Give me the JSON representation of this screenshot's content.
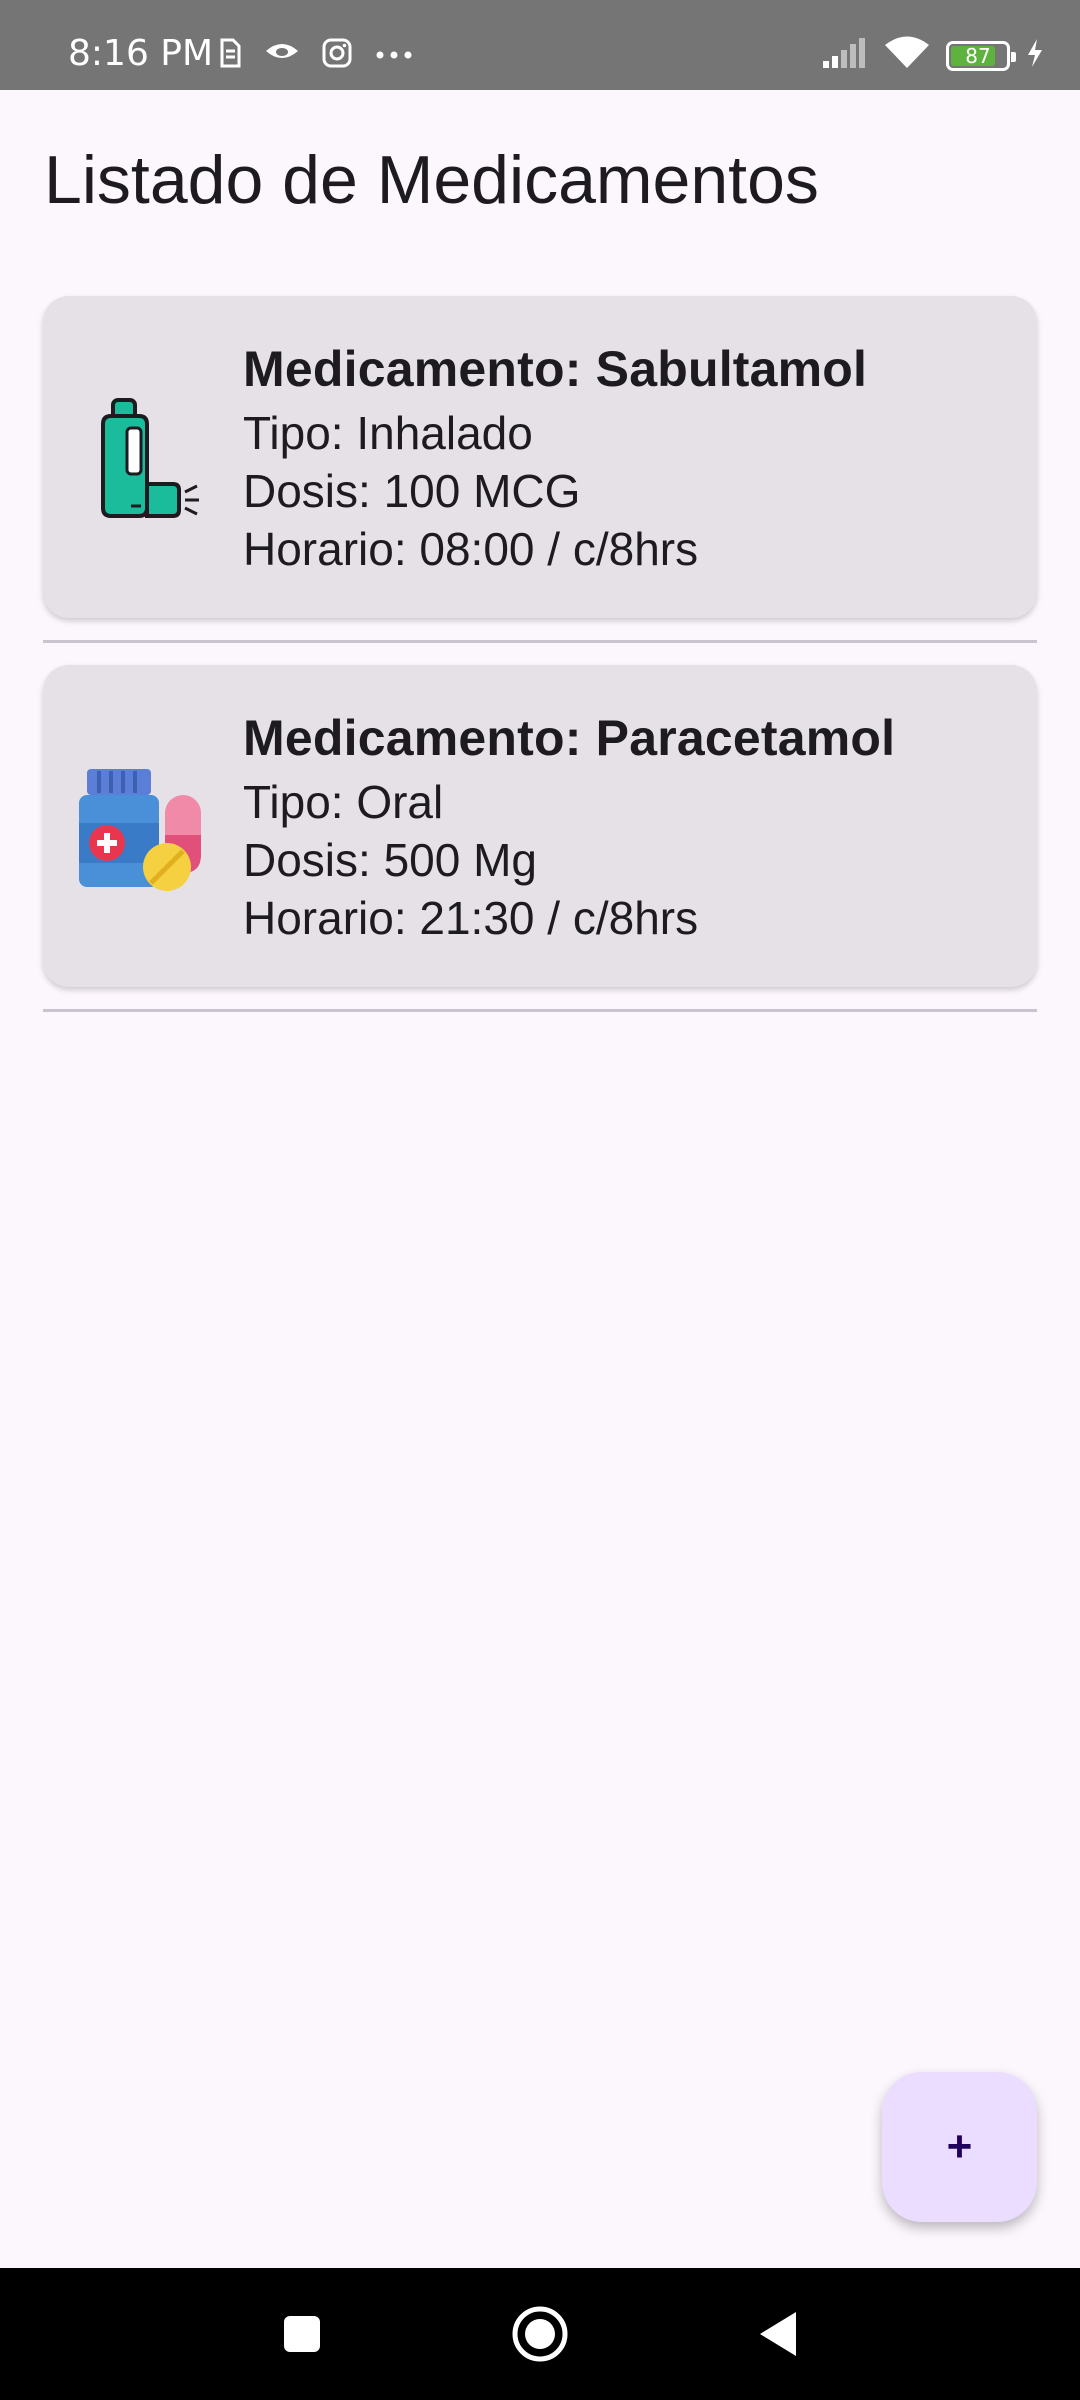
{
  "status_bar": {
    "time": "8:16 PM",
    "battery_level": "87",
    "left_icons": [
      "sim-icon",
      "eye-icon",
      "instagram-icon",
      "more-dots-icon"
    ],
    "right_icons": [
      "signal-icon",
      "wifi-icon",
      "battery-icon",
      "charging-icon"
    ]
  },
  "header": {
    "title": "Listado de Medicamentos"
  },
  "medications": [
    {
      "icon": "inhaler-icon",
      "name": "Medicamento: Sabultamol",
      "type": "Tipo: Inhalado",
      "dose": "Dosis: 100 MCG",
      "schedule": "Horario: 08:00 / c/8hrs"
    },
    {
      "icon": "pill-bottle-icon",
      "name": "Medicamento: Paracetamol",
      "type": "Tipo: Oral",
      "dose": "Dosis: 500 Mg",
      "schedule": "Horario: 21:30 / c/8hrs"
    }
  ],
  "fab": {
    "label": "+"
  },
  "nav_bar": {
    "buttons": [
      "recents-button",
      "home-button",
      "back-button"
    ]
  },
  "colors": {
    "background": "#fcf6fd",
    "card": "#e6e1e7",
    "fab": "#eaddff",
    "status_bar": "#757575"
  }
}
